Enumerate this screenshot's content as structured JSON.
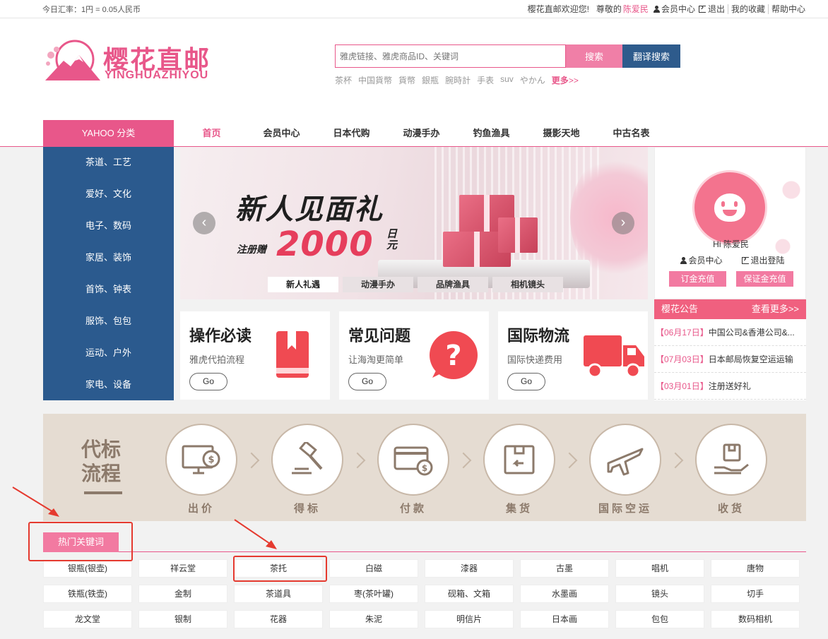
{
  "topbar": {
    "rate": "今日汇率：1円 = 0.05人民币",
    "welcome": "樱花直邮欢迎您!",
    "greeting": "尊敬的",
    "username": "陈爱民",
    "member_center": "会员中心",
    "logout": "退出",
    "favorites": "我的收藏",
    "help": "帮助中心"
  },
  "logo": {
    "cn": "樱花直邮",
    "en": "YINGHUAZHIYOU"
  },
  "search": {
    "placeholder": "雅虎链接、雅虎商品ID、关键词",
    "search_label": "搜索",
    "translate_label": "翻译搜索",
    "hot_terms": [
      "茶杯",
      "中国貨幣",
      "貨幣",
      "銀瓶",
      "腕時計",
      "手表",
      "suv",
      "やかん"
    ],
    "more_label": "更多",
    "more_arrow": ">>"
  },
  "nav": {
    "category_title": "YAHOO 分类",
    "items": [
      "首页",
      "会员中心",
      "日本代购",
      "动漫手办",
      "钓鱼渔具",
      "摄影天地",
      "中古名表"
    ]
  },
  "categories": [
    "茶道、工艺",
    "爱好、文化",
    "电子、数码",
    "家居、装饰",
    "首饰、钟表",
    "服饰、包包",
    "运动、户外",
    "家电、设备"
  ],
  "banner": {
    "title": "新人见面礼",
    "register_gift": "注册赠",
    "amount": "2000",
    "unit": "日元",
    "tabs": [
      "新人礼遇",
      "动漫手办",
      "品牌渔具",
      "相机镜头"
    ]
  },
  "user_panel": {
    "hi": "Hi 陈爱民",
    "member_center": "会员中心",
    "logout": "退出登陆",
    "order_recharge": "订金充值",
    "deposit_recharge": "保证金充值"
  },
  "notice": {
    "title": "樱花公告",
    "more": "查看更多>>",
    "items": [
      {
        "date": "【06月17日】",
        "text": "中国公司&香港公司&..."
      },
      {
        "date": "【07月03日】",
        "text": "日本邮局恢复空运运输"
      },
      {
        "date": "【03月01日】",
        "text": "注册送好礼"
      }
    ]
  },
  "cards": [
    {
      "title": "操作必读",
      "subtitle": "雅虎代拍流程",
      "go": "Go",
      "icon": "bookmark-book-icon"
    },
    {
      "title": "常见问题",
      "subtitle": "让海淘更简单",
      "go": "Go",
      "icon": "question-bubble-icon"
    },
    {
      "title": "国际物流",
      "subtitle": "国际快递费用",
      "go": "Go",
      "icon": "truck-icon"
    }
  ],
  "process": {
    "title": "代标流程",
    "steps": [
      "出价",
      "得标",
      "付款",
      "集货",
      "国际空运",
      "收货"
    ]
  },
  "keywords": {
    "title": "热门关键词",
    "items": [
      "银瓶(银壶)",
      "祥云堂",
      "茶托",
      "白磁",
      "漆器",
      "古墨",
      "唱机",
      "唐物",
      "铁瓶(铁壶)",
      "金制",
      "茶道具",
      "枣(茶叶罐)",
      "砚箱、文箱",
      "水墨画",
      "镜头",
      "切手",
      "龙文堂",
      "银制",
      "花器",
      "朱泥",
      "明信片",
      "日本画",
      "包包",
      "数码相机"
    ]
  },
  "colors": {
    "brand_pink": "#e8578a",
    "navy": "#2b5a8e",
    "annotation_red": "#e53a2f"
  }
}
